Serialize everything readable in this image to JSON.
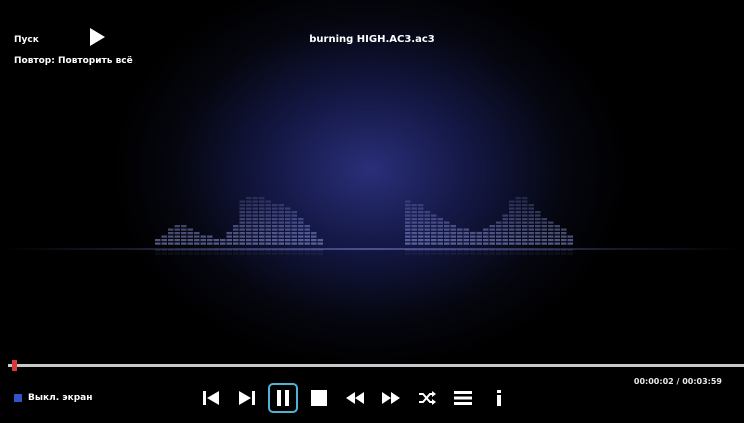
{
  "status": {
    "play_label": "Пуск",
    "repeat_label": "Повтор: Повторить всё"
  },
  "track": {
    "title": "burning HIGH.AC3.ac3"
  },
  "playback": {
    "time": "00:00:02 / 00:03:59",
    "progress_fraction": 0.008
  },
  "footer": {
    "screen_off_label": "Выкл. экран"
  },
  "controls": [
    {
      "name": "previous-button",
      "icon": "skip-previous-icon"
    },
    {
      "name": "next-button",
      "icon": "skip-next-icon"
    },
    {
      "name": "pause-button",
      "icon": "pause-icon",
      "active": true
    },
    {
      "name": "stop-button",
      "icon": "stop-icon"
    },
    {
      "name": "rewind-button",
      "icon": "rewind-icon"
    },
    {
      "name": "fast-forward-button",
      "icon": "fast-forward-icon"
    },
    {
      "name": "shuffle-button",
      "icon": "shuffle-icon"
    },
    {
      "name": "playlist-button",
      "icon": "playlist-icon"
    },
    {
      "name": "info-button",
      "icon": "info-icon"
    }
  ],
  "colors": {
    "accent": "#4fb3d8",
    "progress_handle": "#d8373a",
    "screen_off_marker": "#2f55c8"
  }
}
